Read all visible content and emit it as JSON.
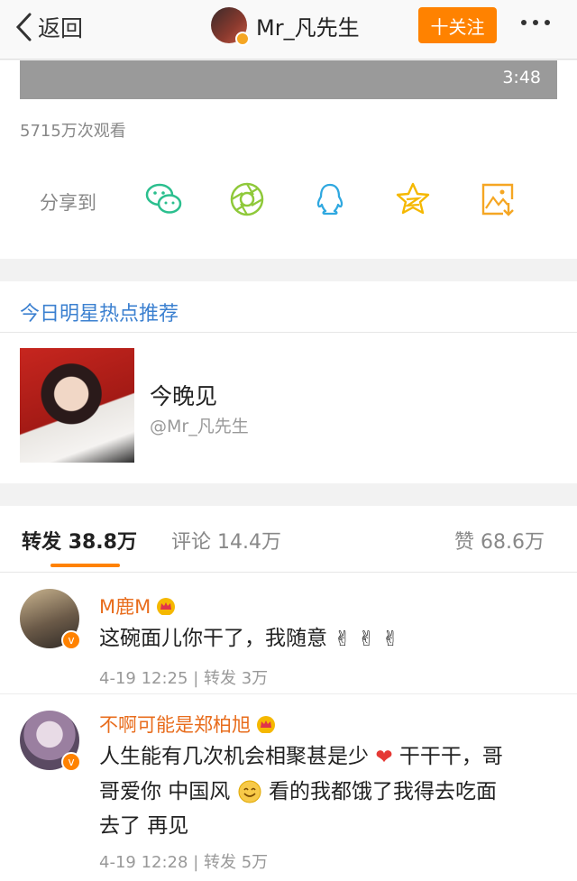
{
  "nav": {
    "back_label": "返回",
    "username": "Mr_凡先生",
    "follow_label": "十关注"
  },
  "video": {
    "duration": "3:48",
    "views": "5715万次观看"
  },
  "share": {
    "label": "分享到",
    "targets": [
      "wechat-icon",
      "moments-icon",
      "qq-icon",
      "qzone-icon",
      "save-image-icon"
    ]
  },
  "recommend": {
    "section_title": "今日明星热点推荐",
    "title": "今晚见",
    "handle": "@Mr_凡先生"
  },
  "tabs": {
    "repost_label": "转发",
    "repost_count": "38.8万",
    "comment_label": "评论",
    "comment_count": "14.4万",
    "like_label": "赞",
    "like_count": "68.6万"
  },
  "comments": [
    {
      "user": "M鹿M",
      "text": "这碗面儿你干了，我随意",
      "time": "4-19 12:25",
      "repost_label": "转发",
      "repost_count": "3万"
    },
    {
      "user": "不啊可能是郑柏旭",
      "text_1": "人生能有几次机会相聚甚是少",
      "text_2": "干干干，哥",
      "text_3": "哥爱你 中国风",
      "text_4": "看的我都饿了我得去吃面",
      "text_5": "去了 再见",
      "time": "4-19 12:28",
      "repost_label": "转发",
      "repost_count": "5万"
    }
  ],
  "colors": {
    "accent": "#ff8200",
    "link": "#3b80d0",
    "username": "#e86c1c"
  }
}
